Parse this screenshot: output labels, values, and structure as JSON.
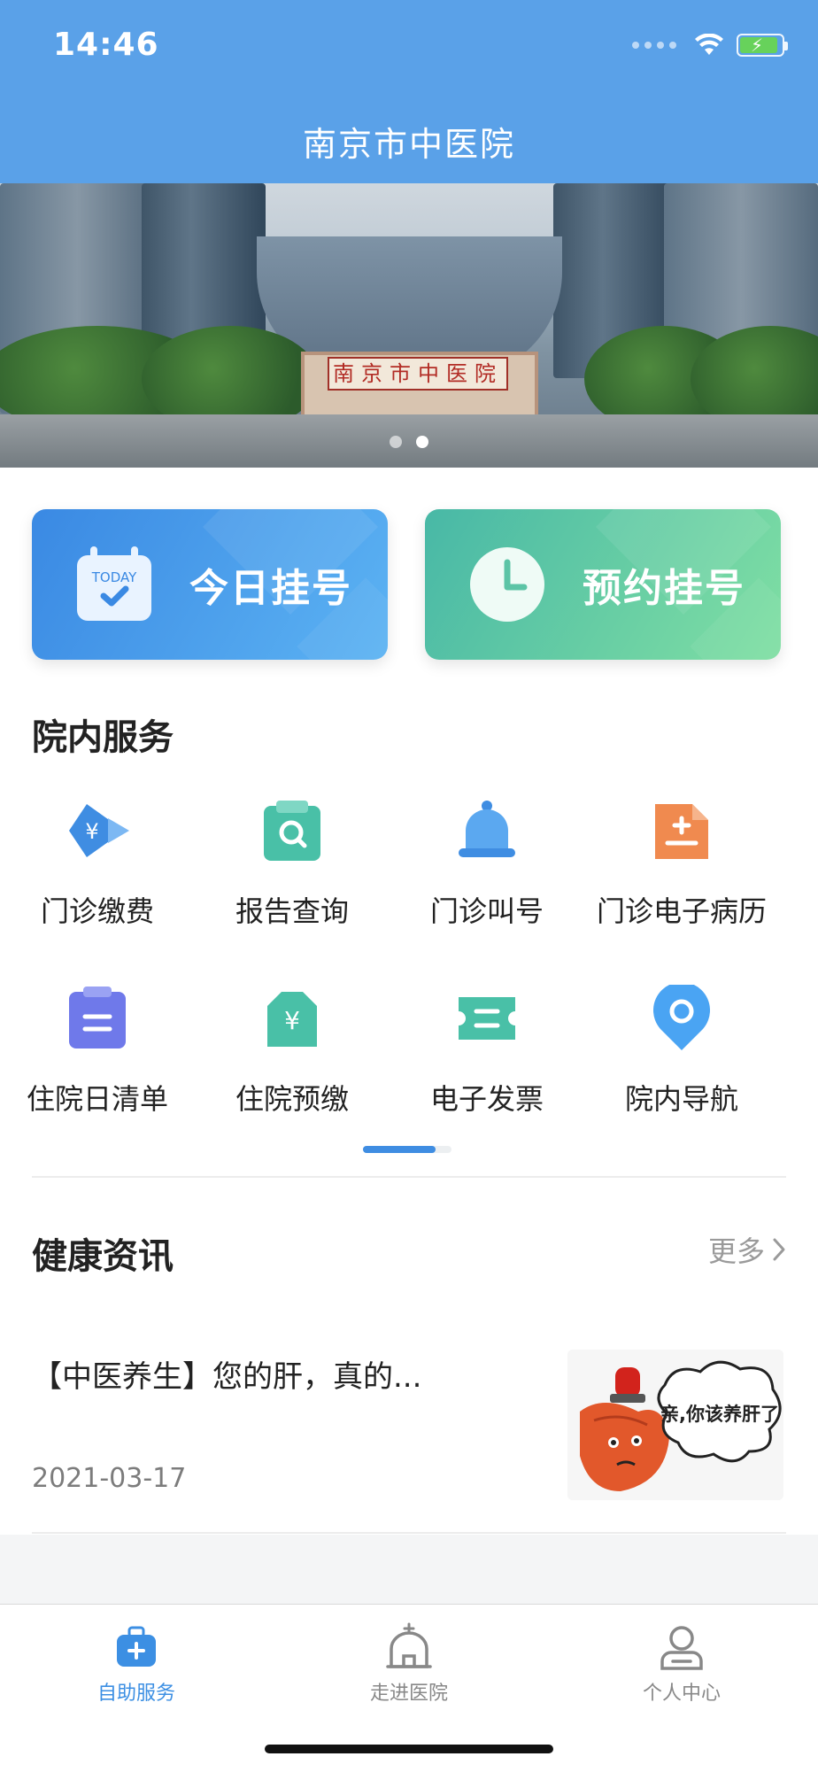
{
  "status": {
    "time": "14:46"
  },
  "header": {
    "title": "南京市中医院"
  },
  "banner": {
    "sign_text": "南京市中医院",
    "dots": 2,
    "active_dot": 2
  },
  "registration": {
    "today": {
      "label": "今日挂号",
      "icon_text": "TODAY",
      "icon": "calendar-today-icon"
    },
    "appointment": {
      "label": "预约挂号",
      "icon": "clock-icon"
    }
  },
  "services": {
    "title": "院内服务",
    "items": [
      {
        "label": "门诊缴费",
        "icon": "payment-icon",
        "color": "#3f8de2"
      },
      {
        "label": "报告查询",
        "icon": "report-search-icon",
        "color": "#49c0a7"
      },
      {
        "label": "门诊叫号",
        "icon": "bell-icon",
        "color": "#3f8de2"
      },
      {
        "label": "门诊电子病历",
        "icon": "medical-record-icon",
        "color": "#f08a4f"
      },
      {
        "label": "住院日清单",
        "icon": "daily-list-icon",
        "color": "#6f79ea"
      },
      {
        "label": "住院预缴",
        "icon": "prepay-icon",
        "color": "#49c0a7"
      },
      {
        "label": "电子发票",
        "icon": "invoice-icon",
        "color": "#49c0a7"
      },
      {
        "label": "院内导航",
        "icon": "location-icon",
        "color": "#3f8de2"
      }
    ]
  },
  "news": {
    "title": "健康资讯",
    "more_label": "更多",
    "items": [
      {
        "title": "【中医养生】您的肝，真的...",
        "date": "2021-03-17",
        "thumb_caption": "亲,你该养肝了"
      }
    ]
  },
  "tabbar": {
    "items": [
      {
        "label": "自助服务",
        "icon": "medical-kit-icon",
        "active": true
      },
      {
        "label": "走进医院",
        "icon": "hospital-icon",
        "active": false
      },
      {
        "label": "个人中心",
        "icon": "user-icon",
        "active": false
      }
    ]
  },
  "colors": {
    "header": "#5aa1e8",
    "accent_blue": "#3f8de2",
    "accent_green": "#49c0a7",
    "accent_orange": "#f08a4f",
    "accent_purple": "#6f79ea"
  }
}
